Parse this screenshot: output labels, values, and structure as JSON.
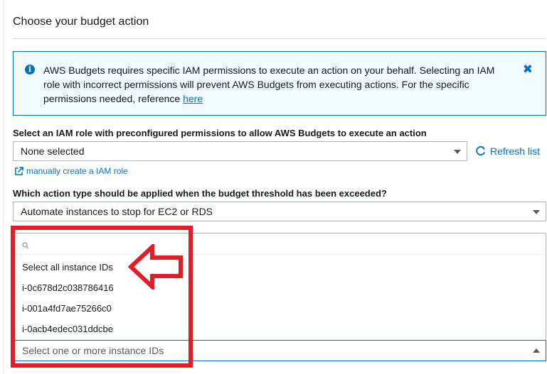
{
  "section": {
    "title": "Choose your budget action"
  },
  "alert": {
    "text": "AWS Budgets requires specific IAM permissions to execute an action on your behalf. Selecting an IAM role with incorrect permissions will prevent AWS Budgets from executing actions. For the specific permissions needed, reference ",
    "link": "here",
    "icon": "info-icon",
    "close_glyph": "✖",
    "color": "#0073bb"
  },
  "iam_role": {
    "label": "Select an IAM role with preconfigured permissions to allow AWS Budgets to execute an action",
    "value": "None selected",
    "refresh_label": "Refresh list",
    "manual_link": "manually create a IAM role"
  },
  "action_type": {
    "label": "Which action type should be applied when the budget threshold has been exceeded?",
    "value": "Automate instances to stop for EC2 or RDS"
  },
  "instances": {
    "options": [
      "Select all instance IDs",
      "i-0c678d2c038786416",
      "i-001a4fd7ae75266c0",
      "i-0acb4edec031ddcbe"
    ],
    "placeholder": "Select one or more instance IDs"
  },
  "annotation": {
    "color": "#e01e27"
  }
}
